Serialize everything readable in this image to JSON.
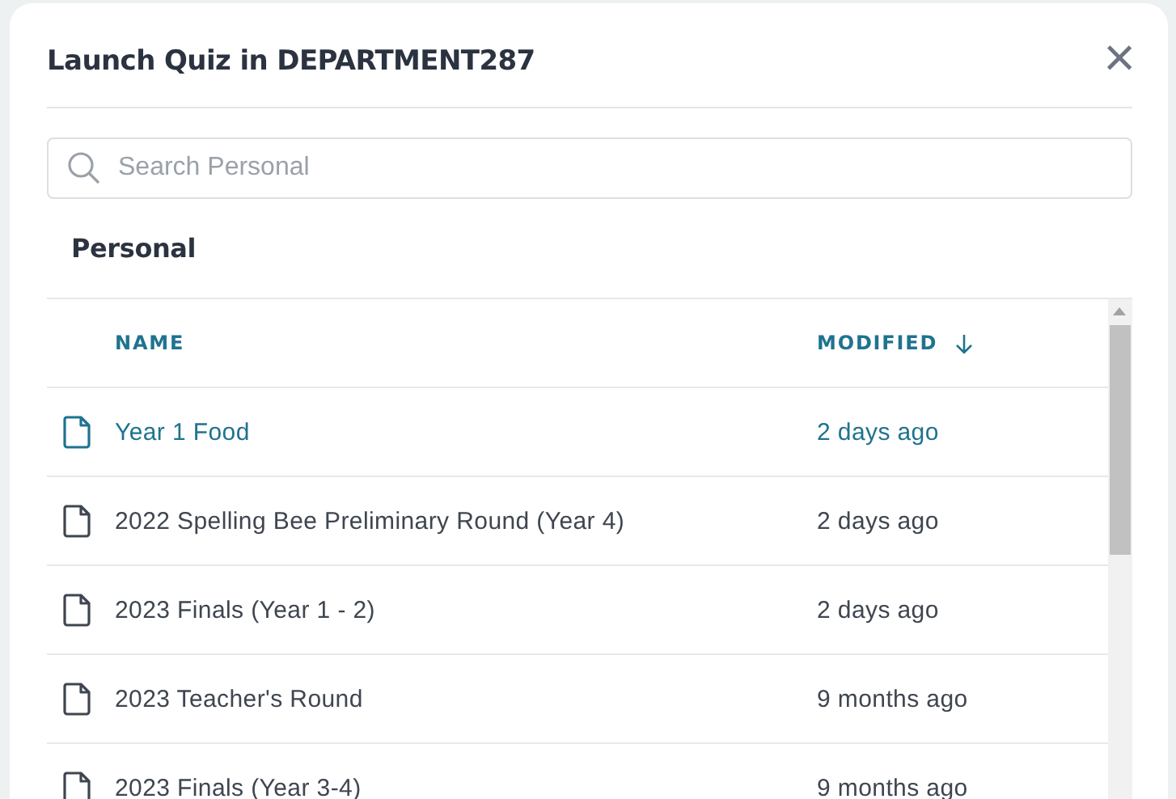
{
  "dialog": {
    "title": "Launch Quiz in DEPARTMENT287",
    "close": "×"
  },
  "search": {
    "placeholder": "Search Personal"
  },
  "section": "Personal",
  "table": {
    "columns": [
      {
        "label": "NAME",
        "sorted": false
      },
      {
        "label": "MODIFIED",
        "sorted": true
      }
    ],
    "rows": [
      {
        "name": "Year 1 Food",
        "modified": "2 days ago",
        "selected": true
      },
      {
        "name": "2022 Spelling Bee Preliminary Round (Year 4)",
        "modified": "2 days ago",
        "selected": false
      },
      {
        "name": "2023 Finals (Year 1 - 2)",
        "modified": "2 days ago",
        "selected": false
      },
      {
        "name": "2023 Teacher's Round",
        "modified": "9 months ago",
        "selected": false
      },
      {
        "name": "2023 Finals (Year 3-4)",
        "modified": "9 months ago",
        "selected": false
      }
    ]
  }
}
